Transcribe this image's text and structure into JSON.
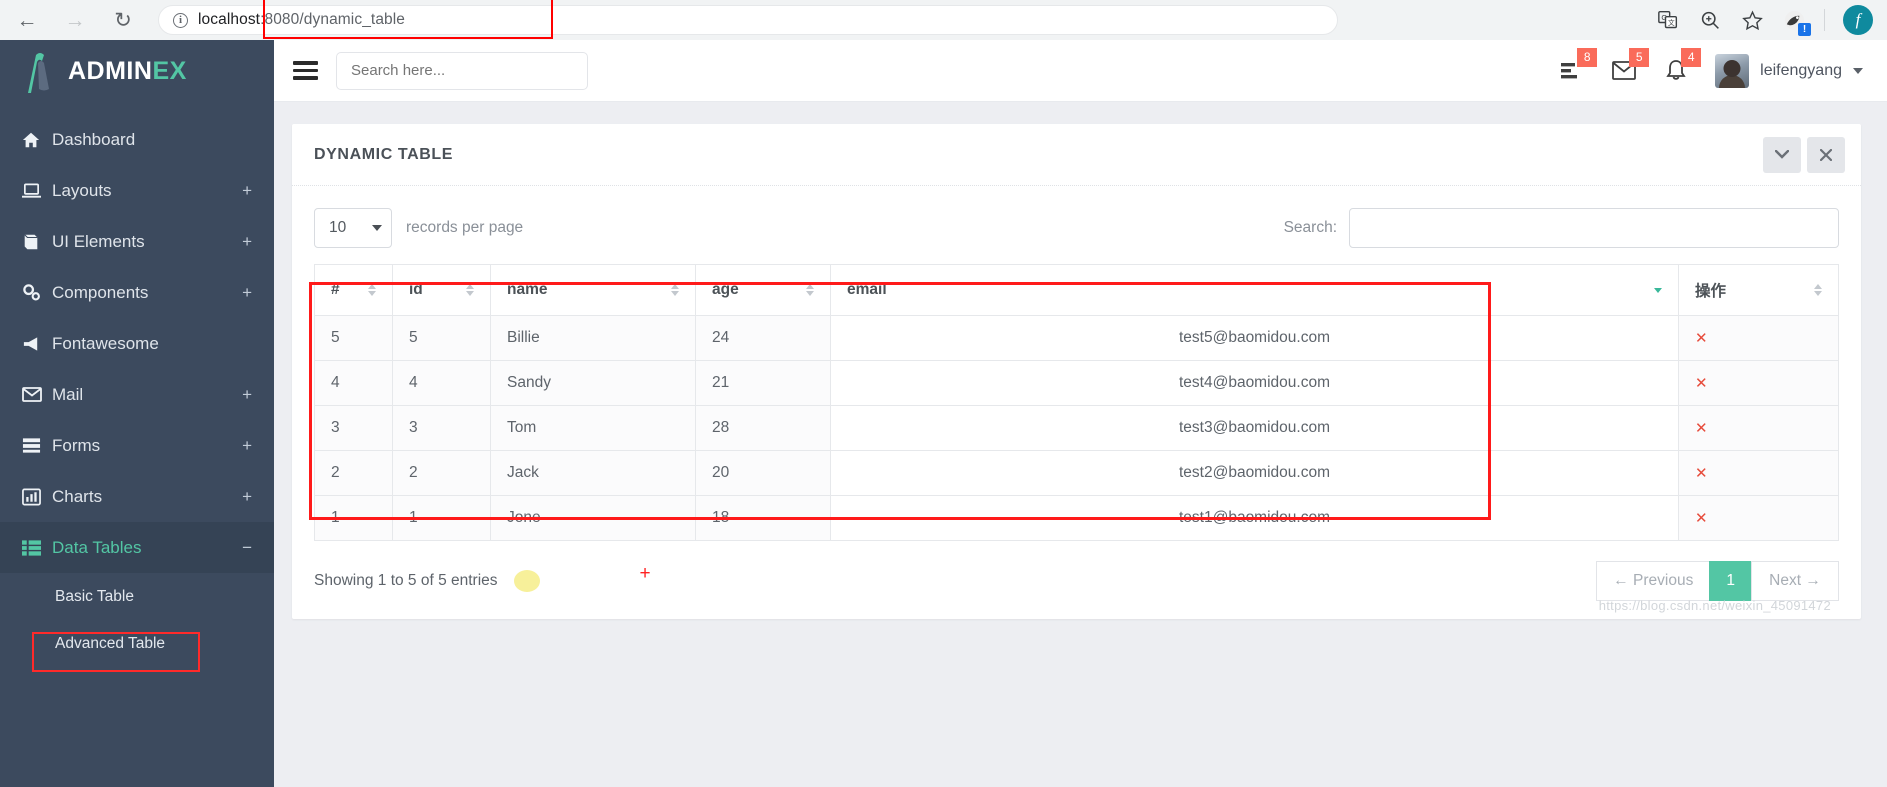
{
  "browser": {
    "back_icon": "arrow-left-icon",
    "forward_icon": "arrow-right-icon",
    "reload_icon": "reload-icon",
    "info_icon": "ⓘ",
    "url_host": "localhost",
    "url_path": ":8080/dynamic_table",
    "translate_icon": "translate-icon",
    "zoom_icon": "zoom-icon",
    "bookmark_icon": "star-icon",
    "extension_badge": "!",
    "profile_initial": "f"
  },
  "sidebar": {
    "logo": {
      "part1": "ADMIN",
      "part2": "EX"
    },
    "items": [
      {
        "label": "Dashboard",
        "icon": "home-icon",
        "expand": "",
        "active": false
      },
      {
        "label": "Layouts",
        "icon": "laptop-icon",
        "expand": "+",
        "active": false
      },
      {
        "label": "UI Elements",
        "icon": "book-icon",
        "expand": "+",
        "active": false
      },
      {
        "label": "Components",
        "icon": "gears-icon",
        "expand": "+",
        "active": false
      },
      {
        "label": "Fontawesome",
        "icon": "bullhorn-icon",
        "expand": "",
        "active": false
      },
      {
        "label": "Mail",
        "icon": "envelope-icon",
        "expand": "+",
        "active": false
      },
      {
        "label": "Forms",
        "icon": "forms-icon",
        "expand": "+",
        "active": false
      },
      {
        "label": "Charts",
        "icon": "chart-bar-icon",
        "expand": "+",
        "active": false
      },
      {
        "label": "Data Tables",
        "icon": "table-list-icon",
        "expand": "−",
        "active": true
      }
    ],
    "subitems": [
      {
        "label": "Basic Table"
      },
      {
        "label": "Advanced Table"
      }
    ]
  },
  "topnav": {
    "menu_toggle_icon": "hamburger-icon",
    "search_placeholder": "Search here...",
    "icons": [
      {
        "name": "tasks-icon",
        "badge": "8"
      },
      {
        "name": "envelope-icon",
        "badge": "5"
      },
      {
        "name": "bell-icon",
        "badge": "4"
      }
    ],
    "user_name": "leifengyang"
  },
  "card": {
    "title": "DYNAMIC TABLE",
    "collapse_icon": "chevron-down-icon",
    "close_icon": "close-icon"
  },
  "table_controls": {
    "page_length_value": "10",
    "page_length_label": "records per page",
    "search_label": "Search:",
    "search_value": "",
    "search_placeholder": ""
  },
  "table": {
    "columns": [
      {
        "label": "#",
        "sort": "none"
      },
      {
        "label": "id",
        "sort": "none"
      },
      {
        "label": "name",
        "sort": "none"
      },
      {
        "label": "age",
        "sort": "none"
      },
      {
        "label": "email",
        "sort": "desc"
      },
      {
        "label": "操作",
        "sort": "none"
      }
    ],
    "rows": [
      {
        "num": "5",
        "id": "5",
        "name": "Billie",
        "age": "24",
        "email": "test5@baomidou.com",
        "op": "✕"
      },
      {
        "num": "4",
        "id": "4",
        "name": "Sandy",
        "age": "21",
        "email": "test4@baomidou.com",
        "op": "✕"
      },
      {
        "num": "3",
        "id": "3",
        "name": "Tom",
        "age": "28",
        "email": "test3@baomidou.com",
        "op": "✕"
      },
      {
        "num": "2",
        "id": "2",
        "name": "Jack",
        "age": "20",
        "email": "test2@baomidou.com",
        "op": "✕"
      },
      {
        "num": "1",
        "id": "1",
        "name": "Jone",
        "age": "18",
        "email": "test1@baomidou.com",
        "op": "✕"
      }
    ]
  },
  "footer": {
    "info": "Showing 1 to 5 of 5 entries",
    "plus_marker": "+",
    "previous_label": "← Previous",
    "page_number": "1",
    "next_label": "Next →",
    "watermark": "https://blog.csdn.net/weixin_45091472"
  },
  "colors": {
    "sidebar_bg": "#3c4a5e",
    "accent_teal": "#53c6a4",
    "badge_red": "#fa6b5a",
    "annotation_red": "#ff1a1a"
  }
}
